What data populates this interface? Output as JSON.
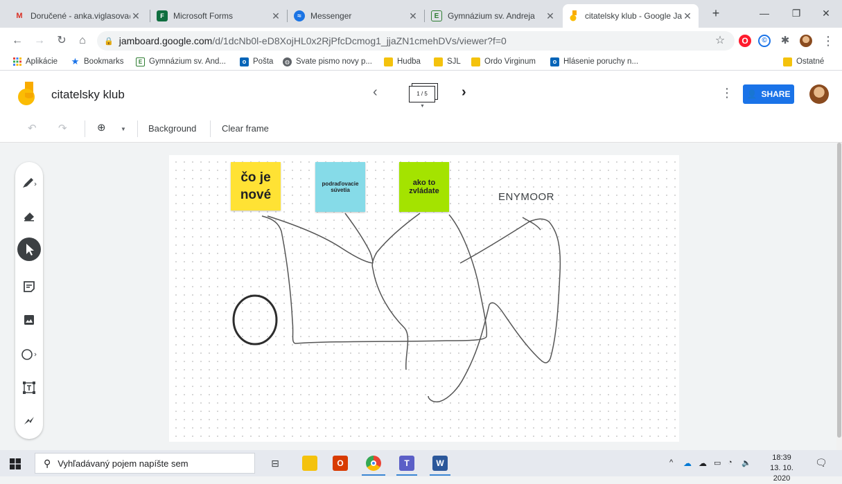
{
  "browser": {
    "tabs": [
      {
        "title": "Doručené - anka.viglasova@",
        "icon": "gmail-icon",
        "icon_color": "#d93025",
        "glyph": "M"
      },
      {
        "title": "Microsoft Forms",
        "icon": "forms-icon",
        "icon_color": "#0f6e3f",
        "glyph": "F"
      },
      {
        "title": "Messenger",
        "icon": "messenger-icon",
        "icon_color": "#1b74e4",
        "glyph": "~"
      },
      {
        "title": "Gymnázium sv. Andreja",
        "icon": "gymnazium-icon",
        "icon_color": "#2e7d32",
        "glyph": "E"
      },
      {
        "title": "citatelsky klub - Google Jam",
        "icon": "jamboard-icon",
        "icon_color": "#f9ab00",
        "glyph": ""
      }
    ],
    "new_tab": "+",
    "window_controls": {
      "minimize": "—",
      "restore": "❐",
      "close": "✕"
    },
    "url_host": "jamboard.google.com",
    "url_path": "/d/1dcNb0l-eD8XojHL0x2RjPfcDcmog1_jjaZN1cmehDVs/viewer?f=0",
    "bookmarks": [
      {
        "label": "Aplikácie",
        "icon": "apps-grid-icon"
      },
      {
        "label": "Bookmarks",
        "icon": "star-icon"
      },
      {
        "label": "Gymnázium sv. And...",
        "icon": "gymnazium-icon"
      },
      {
        "label": "Pošta",
        "icon": "outlook-icon"
      },
      {
        "label": "Svate pismo novy p...",
        "icon": "globe-icon"
      },
      {
        "label": "Hudba",
        "icon": "folder-icon"
      },
      {
        "label": "SJL",
        "icon": "folder-icon"
      },
      {
        "label": "Ordo Virginum",
        "icon": "folder-icon"
      },
      {
        "label": "Hlásenie poruchy n...",
        "icon": "outlook-icon"
      }
    ],
    "other_bookmarks": "Ostatné"
  },
  "app": {
    "title": "citatelsky klub",
    "frame_indicator": "1 / 5",
    "share_label": "SHARE",
    "toolbar": {
      "zoom_icon": "zoom-in-icon",
      "background_label": "Background",
      "clear_frame_label": "Clear frame"
    },
    "side_tools": [
      "pen-icon",
      "eraser-icon",
      "select-icon",
      "sticky-note-icon",
      "image-icon",
      "circle-icon",
      "text-box-icon",
      "laser-icon"
    ]
  },
  "canvas": {
    "notes": [
      {
        "text": "čo je nové",
        "color": "#ffe234"
      },
      {
        "text": "podraďovacie súvetia",
        "color": "#86dbe8"
      },
      {
        "text": "ako to zvládate",
        "color": "#a4e300"
      }
    ],
    "label": "ENYMOOR"
  },
  "taskbar": {
    "search_placeholder": "Vyhľadávaný pojem napíšte sem",
    "time": "18:39",
    "date": "13. 10. 2020"
  }
}
